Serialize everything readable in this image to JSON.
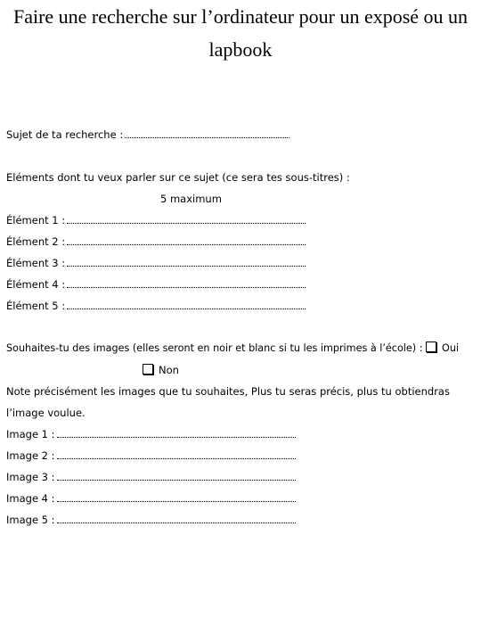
{
  "title": "Faire une recherche sur l’ordinateur pour un exposé ou un lapbook",
  "subject": {
    "label": "Sujet de ta recherche :"
  },
  "elements": {
    "intro": "Eléments dont tu veux parler sur ce sujet (ce sera tes sous-titres) :",
    "note": "5 maximum",
    "items": [
      "Élément 1 :",
      "Élément 2 :",
      "Élément 3 :",
      "Élément 4 :",
      "Élément 5 :"
    ]
  },
  "images": {
    "question": "Souhaites-tu des images (elles seront en noir et blanc si tu les imprimes à l’école) :",
    "option_yes": "Oui",
    "option_no": "Non",
    "instruction_1": "Note précisément les images que tu souhaites, Plus tu seras précis, plus tu obtiendras",
    "instruction_2": "l’image voulue.",
    "items": [
      "Image 1 :",
      "Image 2 :",
      "Image 3 :",
      "Image 4 :",
      "Image 5 :"
    ]
  }
}
